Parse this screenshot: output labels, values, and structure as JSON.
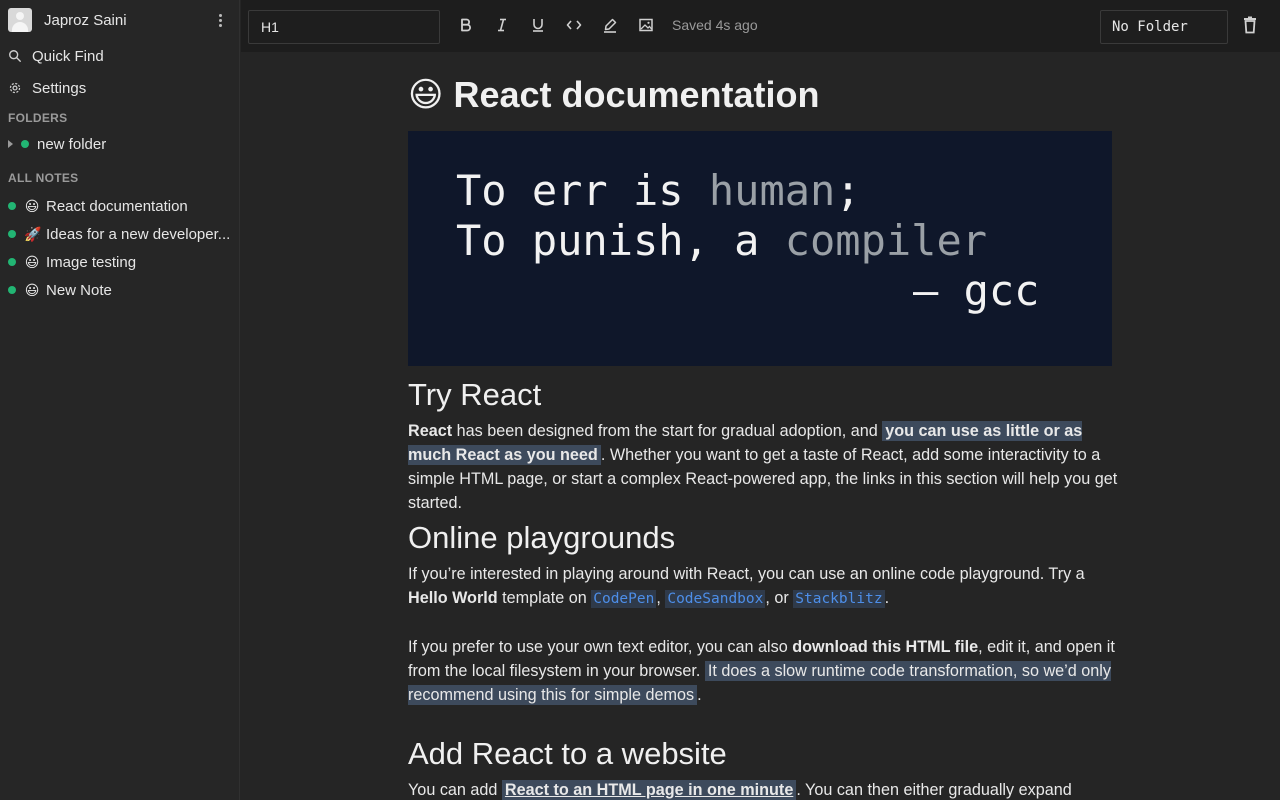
{
  "sidebar": {
    "user_name": "Japroz Saini",
    "quick_find": "Quick Find",
    "settings": "Settings",
    "folders_label": "FOLDERS",
    "folders": [
      {
        "name": "new folder",
        "status_color": "#22b573"
      }
    ],
    "all_notes_label": "ALL NOTES",
    "notes": [
      {
        "emoji": "😃",
        "title": "React documentation"
      },
      {
        "emoji": "🚀",
        "title": "Ideas for a new developer..."
      },
      {
        "emoji": "😃",
        "title": "Image testing"
      },
      {
        "emoji": "😃",
        "title": "New Note"
      }
    ]
  },
  "toolbar": {
    "block_type": "H1",
    "saved_status": "Saved 4s ago",
    "folder": "No Folder",
    "tools": [
      "bold-icon",
      "italic-icon",
      "underline-icon",
      "code-icon",
      "highlight-icon",
      "image-icon"
    ]
  },
  "document": {
    "emoji": "😃",
    "title": "React documentation",
    "code_image": {
      "line1_a": "To err is ",
      "line1_b": "human",
      "line1_c": ";",
      "line2_a": "To punish, a ",
      "line2_b": "compiler",
      "line3": "– gcc"
    },
    "try_react": {
      "heading": "Try React",
      "p_bold": "React",
      "p_1": " has been designed from the start for gradual adoption, and ",
      "p_hl": "you can use as little or as much React as you need",
      "p_2": ". Whether you want to get a taste of React, add some interactivity to a simple HTML page, or start a complex React-powered app, the links in this section will help you get started."
    },
    "playgrounds": {
      "heading": "Online playgrounds",
      "p1_a": "If you’re interested in playing around with React, you can use an online code playground. Try a ",
      "p1_bold": "Hello World",
      "p1_b": " template on ",
      "link1": "CodePen",
      "sep1": ", ",
      "link2": "CodeSandbox",
      "sep2": ", or ",
      "link3": "Stackblitz",
      "p1_end": ".",
      "p2_a": "If you prefer to use your own text editor, you can also ",
      "p2_bold": "download this HTML file",
      "p2_b": ", edit it, and open it from the local filesystem in your browser. ",
      "p2_hl": "It does a slow runtime code transformation, so we’d only recommend using this for simple demos",
      "p2_end": "."
    },
    "add_react": {
      "heading": "Add React to a website",
      "p_a": "You can add ",
      "p_link": "React to an HTML page in one minute",
      "p_b": ". You can then either gradually expand"
    }
  },
  "colors": {
    "accent_dot": "#22b573",
    "highlight": "#3d4a5c",
    "link": "#4d8ee8",
    "image_bg": "#0f172a"
  }
}
